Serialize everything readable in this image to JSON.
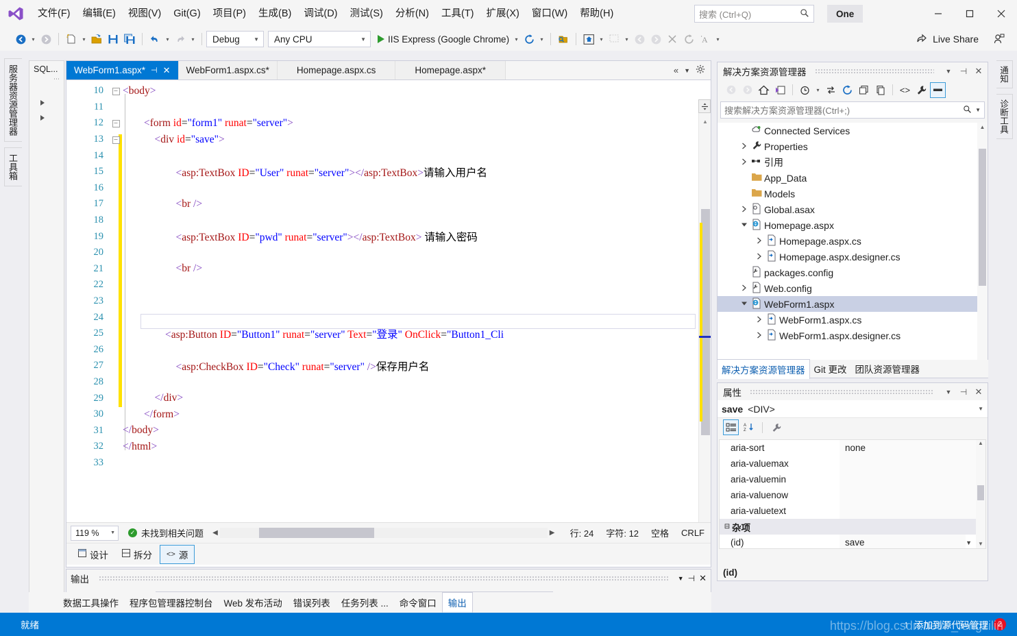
{
  "titlebar": {
    "logo": "vs-logo",
    "menus": [
      {
        "label": "文件(F)"
      },
      {
        "label": "编辑(E)"
      },
      {
        "label": "视图(V)"
      },
      {
        "label": "Git(G)"
      },
      {
        "label": "项目(P)"
      },
      {
        "label": "生成(B)"
      },
      {
        "label": "调试(D)"
      },
      {
        "label": "测试(S)"
      },
      {
        "label": "分析(N)"
      },
      {
        "label": "工具(T)"
      },
      {
        "label": "扩展(X)"
      },
      {
        "label": "窗口(W)"
      },
      {
        "label": "帮助(H)"
      }
    ],
    "search_placeholder": "搜索 (Ctrl+Q)",
    "account_label": "One",
    "minimize": "—",
    "maximize": "□",
    "close": "✕"
  },
  "toolbar": {
    "config_value": "Debug",
    "platform_value": "Any CPU",
    "start_label": "IIS Express (Google Chrome)",
    "live_share_label": "Live Share"
  },
  "left_tabs": [
    {
      "label": "服务器资源管理器"
    },
    {
      "label": "工具箱"
    }
  ],
  "right_tabs": [
    {
      "label": "通知"
    },
    {
      "label": "诊断工具"
    }
  ],
  "sql_panel": {
    "title": "SQL..."
  },
  "editor": {
    "tabs": [
      {
        "label": "WebForm1.aspx*",
        "active": true,
        "pinned": true,
        "closable": true
      },
      {
        "label": "WebForm1.aspx.cs*",
        "active": false
      },
      {
        "label": "Homepage.aspx.cs",
        "active": false
      },
      {
        "label": "Homepage.aspx*",
        "active": false
      }
    ],
    "lines": [
      {
        "n": "10",
        "fold": "minus",
        "indent": 0,
        "tokens": [
          {
            "t": "<",
            "c": "tag"
          },
          {
            "t": "body",
            "c": "tagname"
          },
          {
            "t": ">",
            "c": "tag"
          }
        ]
      },
      {
        "n": "11",
        "fold": "",
        "indent": 0,
        "tokens": []
      },
      {
        "n": "12",
        "fold": "minus",
        "indent": 2,
        "tokens": [
          {
            "t": "<",
            "c": "tag"
          },
          {
            "t": "form ",
            "c": "tagname"
          },
          {
            "t": "id",
            "c": "attr"
          },
          {
            "t": "=",
            "c": "blk"
          },
          {
            "t": "\"form1\"",
            "c": "val"
          },
          {
            "t": " ",
            "c": "blk"
          },
          {
            "t": "runat",
            "c": "attr"
          },
          {
            "t": "=",
            "c": "blk"
          },
          {
            "t": "\"server\"",
            "c": "val"
          },
          {
            "t": ">",
            "c": "tag"
          }
        ]
      },
      {
        "n": "13",
        "fold": "minus",
        "indent": 3,
        "tokens": [
          {
            "t": "<",
            "c": "tag"
          },
          {
            "t": "div ",
            "c": "tagname"
          },
          {
            "t": "id",
            "c": "attr"
          },
          {
            "t": "=",
            "c": "blk"
          },
          {
            "t": "\"save\"",
            "c": "val"
          },
          {
            "t": ">",
            "c": "tag"
          }
        ]
      },
      {
        "n": "14",
        "fold": "",
        "indent": 0,
        "tokens": []
      },
      {
        "n": "15",
        "fold": "",
        "indent": 5,
        "tokens": [
          {
            "t": "<",
            "c": "tag"
          },
          {
            "t": "asp:TextBox ",
            "c": "tagname"
          },
          {
            "t": "ID",
            "c": "attr"
          },
          {
            "t": "=",
            "c": "blk"
          },
          {
            "t": "\"User\"",
            "c": "val"
          },
          {
            "t": " ",
            "c": "blk"
          },
          {
            "t": "runat",
            "c": "attr"
          },
          {
            "t": "=",
            "c": "blk"
          },
          {
            "t": "\"server\"",
            "c": "val"
          },
          {
            "t": ">",
            "c": "tag"
          },
          {
            "t": "</",
            "c": "tag"
          },
          {
            "t": "asp:TextBox",
            "c": "tagname"
          },
          {
            "t": ">",
            "c": "tag"
          },
          {
            "t": "请输入用户名",
            "c": "blk"
          }
        ]
      },
      {
        "n": "16",
        "fold": "",
        "indent": 0,
        "tokens": []
      },
      {
        "n": "17",
        "fold": "",
        "indent": 5,
        "tokens": [
          {
            "t": "<",
            "c": "tag"
          },
          {
            "t": "br ",
            "c": "tagname"
          },
          {
            "t": "/>",
            "c": "tag"
          }
        ]
      },
      {
        "n": "18",
        "fold": "",
        "indent": 0,
        "tokens": []
      },
      {
        "n": "19",
        "fold": "",
        "indent": 5,
        "tokens": [
          {
            "t": "<",
            "c": "tag"
          },
          {
            "t": "asp:TextBox ",
            "c": "tagname"
          },
          {
            "t": "ID",
            "c": "attr"
          },
          {
            "t": "=",
            "c": "blk"
          },
          {
            "t": "\"pwd\"",
            "c": "val"
          },
          {
            "t": " ",
            "c": "blk"
          },
          {
            "t": "runat",
            "c": "attr"
          },
          {
            "t": "=",
            "c": "blk"
          },
          {
            "t": "\"server\"",
            "c": "val"
          },
          {
            "t": ">",
            "c": "tag"
          },
          {
            "t": "</",
            "c": "tag"
          },
          {
            "t": "asp:TextBox",
            "c": "tagname"
          },
          {
            "t": ">",
            "c": "tag"
          },
          {
            "t": " 请输入密码",
            "c": "blk"
          }
        ]
      },
      {
        "n": "20",
        "fold": "",
        "indent": 0,
        "tokens": []
      },
      {
        "n": "21",
        "fold": "",
        "indent": 5,
        "tokens": [
          {
            "t": "<",
            "c": "tag"
          },
          {
            "t": "br ",
            "c": "tagname"
          },
          {
            "t": "/>",
            "c": "tag"
          }
        ]
      },
      {
        "n": "22",
        "fold": "",
        "indent": 0,
        "tokens": []
      },
      {
        "n": "23",
        "fold": "",
        "indent": 0,
        "tokens": []
      },
      {
        "n": "24",
        "fold": "",
        "indent": 0,
        "tokens": []
      },
      {
        "n": "25",
        "fold": "",
        "indent": 4,
        "tokens": [
          {
            "t": "<",
            "c": "tag"
          },
          {
            "t": "asp:Button ",
            "c": "tagname"
          },
          {
            "t": "ID",
            "c": "attr"
          },
          {
            "t": "=",
            "c": "blk"
          },
          {
            "t": "\"Button1\"",
            "c": "val"
          },
          {
            "t": " ",
            "c": "blk"
          },
          {
            "t": "runat",
            "c": "attr"
          },
          {
            "t": "=",
            "c": "blk"
          },
          {
            "t": "\"server\"",
            "c": "val"
          },
          {
            "t": " ",
            "c": "blk"
          },
          {
            "t": "Text",
            "c": "attr"
          },
          {
            "t": "=",
            "c": "blk"
          },
          {
            "t": "\"登录\"",
            "c": "val"
          },
          {
            "t": " ",
            "c": "blk"
          },
          {
            "t": "OnClick",
            "c": "attr"
          },
          {
            "t": "=",
            "c": "blk"
          },
          {
            "t": "\"Button1_Cli",
            "c": "val"
          }
        ]
      },
      {
        "n": "26",
        "fold": "",
        "indent": 0,
        "tokens": []
      },
      {
        "n": "27",
        "fold": "",
        "indent": 5,
        "tokens": [
          {
            "t": "<",
            "c": "tag"
          },
          {
            "t": "asp:CheckBox ",
            "c": "tagname"
          },
          {
            "t": "ID",
            "c": "attr"
          },
          {
            "t": "=",
            "c": "blk"
          },
          {
            "t": "\"Check\"",
            "c": "val"
          },
          {
            "t": " ",
            "c": "blk"
          },
          {
            "t": "runat",
            "c": "attr"
          },
          {
            "t": "=",
            "c": "blk"
          },
          {
            "t": "\"server\"",
            "c": "val"
          },
          {
            "t": " ",
            "c": "blk"
          },
          {
            "t": "/>",
            "c": "tag"
          },
          {
            "t": "保存用户名",
            "c": "blk"
          }
        ]
      },
      {
        "n": "28",
        "fold": "",
        "indent": 0,
        "tokens": []
      },
      {
        "n": "29",
        "fold": "",
        "indent": 3,
        "tokens": [
          {
            "t": "</",
            "c": "tag"
          },
          {
            "t": "div",
            "c": "tagname"
          },
          {
            "t": ">",
            "c": "tag"
          }
        ]
      },
      {
        "n": "30",
        "fold": "",
        "indent": 2,
        "tokens": [
          {
            "t": "</",
            "c": "tag"
          },
          {
            "t": "form",
            "c": "tagname"
          },
          {
            "t": ">",
            "c": "tag"
          }
        ]
      },
      {
        "n": "31",
        "fold": "",
        "indent": 0,
        "tokens": [
          {
            "t": "</",
            "c": "tag"
          },
          {
            "t": "body",
            "c": "tagname"
          },
          {
            "t": ">",
            "c": "tag"
          }
        ]
      },
      {
        "n": "32",
        "fold": "",
        "indent": 0,
        "tokens": [
          {
            "t": "</",
            "c": "tag"
          },
          {
            "t": "html",
            "c": "tagname"
          },
          {
            "t": ">",
            "c": "tag"
          }
        ]
      },
      {
        "n": "33",
        "fold": "",
        "indent": 0,
        "tokens": []
      }
    ]
  },
  "editor_status": {
    "zoom": "119 %",
    "issues": "未找到相关问题",
    "line": "行: 24",
    "column": "字符: 12",
    "spaces": "空格",
    "eol": "CRLF"
  },
  "view_bar": {
    "design": "设计",
    "split": "拆分",
    "source": "源"
  },
  "output_panel": {
    "title": "输出",
    "tabs": [
      {
        "label": "数据工具操作",
        "sel": false
      },
      {
        "label": "程序包管理器控制台",
        "sel": false
      },
      {
        "label": "Web 发布活动",
        "sel": false
      },
      {
        "label": "错误列表",
        "sel": false
      },
      {
        "label": "任务列表 ...",
        "sel": false
      },
      {
        "label": "命令窗口",
        "sel": false
      },
      {
        "label": "输出",
        "sel": true
      }
    ]
  },
  "solution_explorer": {
    "title": "解决方案资源管理器",
    "search_placeholder": "搜索解决方案资源管理器(Ctrl+;)",
    "tree": [
      {
        "label": "Connected Services",
        "indent": 1,
        "expander": "",
        "icon": "cloud",
        "sel": false
      },
      {
        "label": "Properties",
        "indent": 1,
        "expander": "collapsed",
        "icon": "wrench",
        "sel": false
      },
      {
        "label": "引用",
        "indent": 1,
        "expander": "collapsed",
        "icon": "refs",
        "sel": false
      },
      {
        "label": "App_Data",
        "indent": 1,
        "expander": "",
        "icon": "folder",
        "sel": false
      },
      {
        "label": "Models",
        "indent": 1,
        "expander": "",
        "icon": "folder",
        "sel": false
      },
      {
        "label": "Global.asax",
        "indent": 1,
        "expander": "collapsed",
        "icon": "asax",
        "sel": false
      },
      {
        "label": "Homepage.aspx",
        "indent": 1,
        "expander": "expanded",
        "icon": "aspx",
        "sel": false
      },
      {
        "label": "Homepage.aspx.cs",
        "indent": 2,
        "expander": "collapsed",
        "icon": "cs",
        "sel": false
      },
      {
        "label": "Homepage.aspx.designer.cs",
        "indent": 2,
        "expander": "collapsed",
        "icon": "cs",
        "sel": false
      },
      {
        "label": "packages.config",
        "indent": 1,
        "expander": "",
        "icon": "config",
        "sel": false
      },
      {
        "label": "Web.config",
        "indent": 1,
        "expander": "collapsed",
        "icon": "config",
        "sel": false
      },
      {
        "label": "WebForm1.aspx",
        "indent": 1,
        "expander": "expanded",
        "icon": "aspx",
        "sel": true
      },
      {
        "label": "WebForm1.aspx.cs",
        "indent": 2,
        "expander": "collapsed",
        "icon": "cs",
        "sel": false
      },
      {
        "label": "WebForm1.aspx.designer.cs",
        "indent": 2,
        "expander": "collapsed",
        "icon": "cs",
        "sel": false
      }
    ],
    "bottom_tabs": [
      {
        "label": "解决方案资源管理器",
        "sel": true
      },
      {
        "label": "Git 更改",
        "sel": false
      },
      {
        "label": "团队资源管理器",
        "sel": false
      }
    ]
  },
  "properties": {
    "title": "属性",
    "object_name": "save",
    "object_type": "<DIV>",
    "rows": [
      {
        "key": "aria-sort",
        "value": "none",
        "category": false
      },
      {
        "key": "aria-valuemax",
        "value": "",
        "category": false
      },
      {
        "key": "aria-valuemin",
        "value": "",
        "category": false
      },
      {
        "key": "aria-valuenow",
        "value": "",
        "category": false
      },
      {
        "key": "aria-valuetext",
        "value": "",
        "category": false
      },
      {
        "key": "杂项",
        "value": "",
        "category": true
      },
      {
        "key": "(id)",
        "value": "save",
        "category": false
      }
    ],
    "description_title": "(id)"
  },
  "statusbar": {
    "ready": "就绪",
    "source_control": "添加到源代码管理",
    "badge_count": "2",
    "watermark": "https://blog.csdn.net/F_fengzilin"
  },
  "colors": {
    "accent": "#0078d4",
    "tab_active": "#0078d4",
    "changebar": "#ffe100",
    "selection": "#c9d0e4",
    "error": "#e81123",
    "ok": "#2d9b2d"
  }
}
